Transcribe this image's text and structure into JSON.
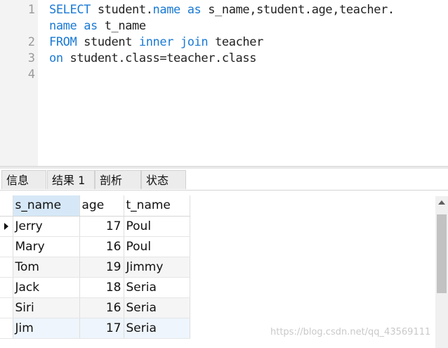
{
  "editor": {
    "lines": [
      {
        "num": "1",
        "tokens": [
          {
            "t": "SELECT",
            "kw": true
          },
          {
            "t": " student.",
            "kw": false
          },
          {
            "t": "name",
            "kw": true
          },
          {
            "t": " ",
            "kw": false
          },
          {
            "t": "as",
            "kw": true
          },
          {
            "t": " s_name,student.age,teacher.",
            "kw": false
          }
        ]
      },
      {
        "num": "",
        "tokens": [
          {
            "t": "name",
            "kw": true
          },
          {
            "t": " ",
            "kw": false
          },
          {
            "t": "as",
            "kw": true
          },
          {
            "t": " t_name",
            "kw": false
          }
        ]
      },
      {
        "num": "2",
        "tokens": [
          {
            "t": "FROM",
            "kw": true
          },
          {
            "t": " student ",
            "kw": false
          },
          {
            "t": "inner",
            "kw": true
          },
          {
            "t": " ",
            "kw": false
          },
          {
            "t": "join",
            "kw": true
          },
          {
            "t": " teacher",
            "kw": false
          }
        ]
      },
      {
        "num": "3",
        "tokens": [
          {
            "t": "on",
            "kw": true
          },
          {
            "t": " student.class=teacher.class",
            "kw": false
          }
        ]
      },
      {
        "num": "4",
        "tokens": []
      }
    ]
  },
  "tabs": [
    {
      "label": "信息",
      "active": false
    },
    {
      "label": "结果 1",
      "active": true
    },
    {
      "label": "剖析",
      "active": false
    },
    {
      "label": "状态",
      "active": false
    }
  ],
  "results": {
    "columns": [
      "s_name",
      "age",
      "t_name"
    ],
    "rows": [
      [
        "Jerry",
        "17",
        "Poul"
      ],
      [
        "Mary",
        "16",
        "Poul"
      ],
      [
        "Tom",
        "19",
        "Jimmy"
      ],
      [
        "Jack",
        "18",
        "Seria"
      ],
      [
        "Siri",
        "16",
        "Seria"
      ],
      [
        "Jim",
        "17",
        "Seria"
      ]
    ],
    "current_row": 0
  },
  "watermark": "https://blog.csdn.net/qq_43569111",
  "colors": {
    "keyword": "#1a7ad4",
    "selected_header": "#d6e8f7"
  }
}
